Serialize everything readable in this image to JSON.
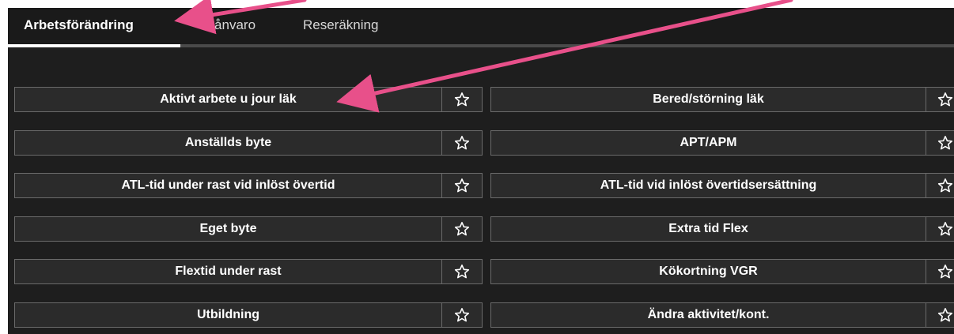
{
  "tabs": [
    {
      "label": "Arbetsförändring",
      "active": true
    },
    {
      "label": "Frånvaro",
      "active": false
    },
    {
      "label": "Reseräkning",
      "active": false
    }
  ],
  "items_left": [
    "Aktivt arbete u jour läk",
    "Anställds byte",
    "ATL-tid under rast vid inlöst övertid",
    "Eget byte",
    "Flextid under rast",
    "Utbildning"
  ],
  "items_right": [
    "Bered/störning läk",
    "APT/APM",
    "ATL-tid vid inlöst övertidsersättning",
    "Extra tid Flex",
    "Kökortning VGR",
    "Ändra aktivitet/kont."
  ],
  "icons": {
    "favorite": "star-outline-icon",
    "annotation": "arrow-icon"
  },
  "colors": {
    "background": "#1e1e1e",
    "button_bg": "#2b2b2b",
    "button_border": "#6a6a6a",
    "text": "#ffffff",
    "annotation_arrow": "#e8508a"
  }
}
